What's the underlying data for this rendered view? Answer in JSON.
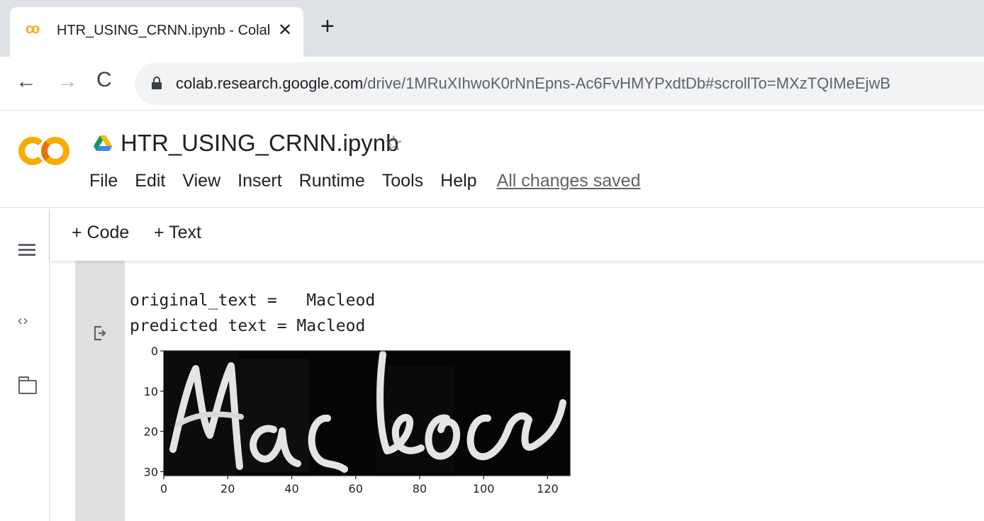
{
  "browser": {
    "tab": {
      "favicon": "co",
      "title": "HTR_USING_CRNN.ipynb - Colab",
      "close_glyph": "✕"
    },
    "new_tab_glyph": "+",
    "nav": {
      "back": "←",
      "forward": "→",
      "reload": "C"
    },
    "url": {
      "host": "colab.research.google.com",
      "path": "/drive/1MRuXIhwoK0rNnEpns-Ac6FvHMYPxdtDb#scrollTo=MXzTQIMeEjwB"
    }
  },
  "colab": {
    "notebook_title": "HTR_USING_CRNN.ipynb",
    "star_glyph": "☆",
    "menu": {
      "file": "File",
      "edit": "Edit",
      "view": "View",
      "insert": "Insert",
      "runtime": "Runtime",
      "tools": "Tools",
      "help": "Help",
      "status": "All changes saved"
    },
    "toolbar": {
      "add_code": "+ Code",
      "add_text": "+ Text"
    },
    "rail": {
      "code_snippets_glyph": "‹›"
    }
  },
  "output": {
    "line1": "original_text =   Macleod",
    "line2": "predicted text = Macleod"
  },
  "plot": {
    "y_ticks": [
      "0",
      "10",
      "20",
      "30"
    ],
    "x_ticks": [
      "0",
      "20",
      "40",
      "60",
      "80",
      "100",
      "120"
    ],
    "image_word": "Macleod",
    "image_extent": {
      "x": [
        0,
        127
      ],
      "y": [
        31,
        0
      ]
    }
  },
  "colors": {
    "tab_strip": "#dee1e6",
    "colab_orange": "#f9ab00",
    "colab_orange_dark": "#e8710a",
    "cell_gutter": "#e0e0e0"
  }
}
